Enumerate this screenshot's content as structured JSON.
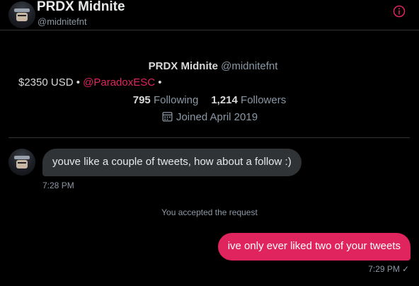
{
  "header": {
    "name": "PRDX Midnite",
    "handle": "@midnitefnt"
  },
  "profile": {
    "name": "PRDX Midnite",
    "handle": "@midnitefnt",
    "bio_prefix": "$2350 USD •",
    "bio_mention": "@ParadoxESC",
    "bio_suffix": "•",
    "following_count": "795",
    "following_label": "Following",
    "followers_count": "1,214",
    "followers_label": "Followers",
    "joined": "Joined April 2019"
  },
  "messages": {
    "incoming_text": "youve like a couple of tweets, how about a follow :)",
    "incoming_time": "7:28 PM",
    "system_text": "You accepted the request",
    "outgoing_text": "ive only ever liked two of your tweets",
    "outgoing_time": "7:29 PM",
    "outgoing_status_icon": "check-icon"
  },
  "colors": {
    "background": "#000000",
    "accent": "#e0245e",
    "bubble_in": "#2f3336",
    "muted": "#8b98a5"
  }
}
